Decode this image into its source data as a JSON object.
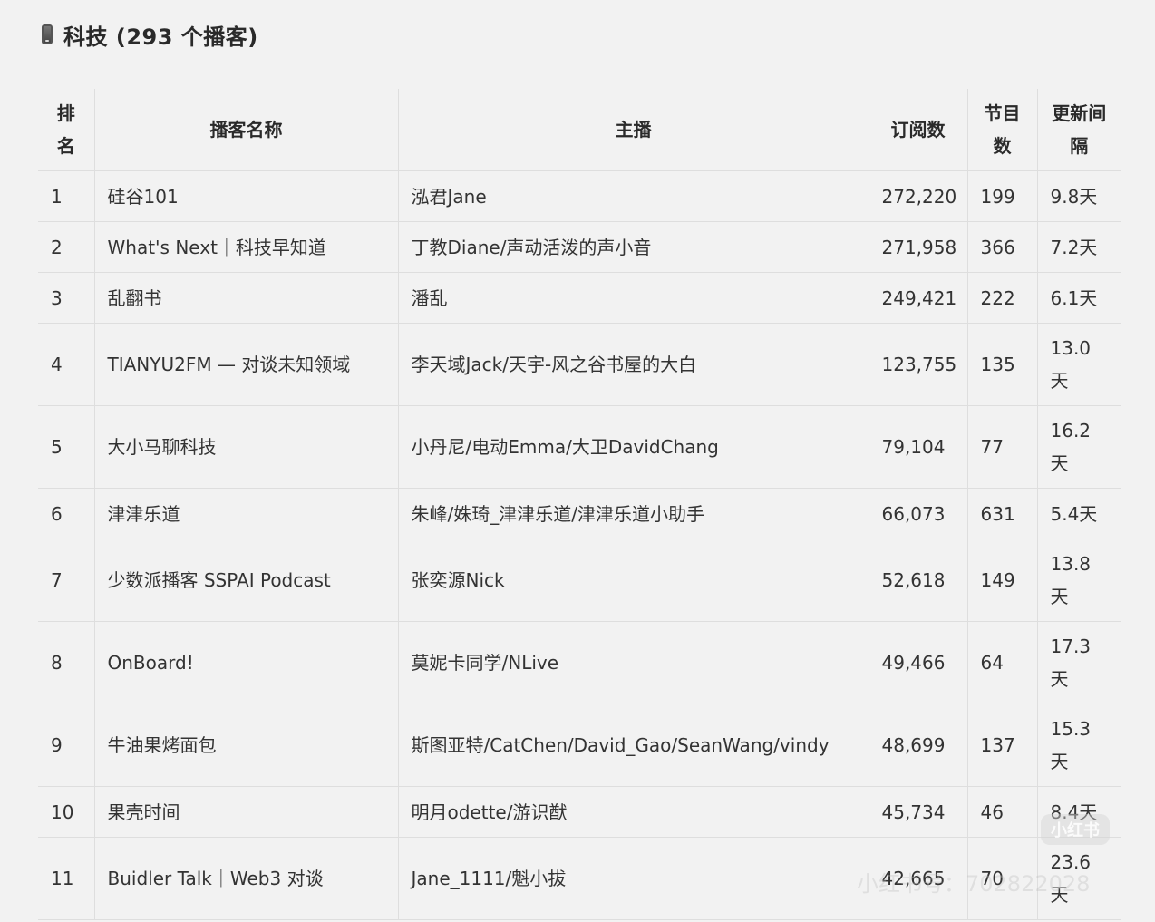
{
  "heading": {
    "icon": "mobile-phone-icon",
    "title": "科技 (293 个播客)"
  },
  "table": {
    "headers": {
      "rank": "排名",
      "name": "播客名称",
      "host": "主播",
      "subscribers": "订阅数",
      "episodes": "节目数",
      "interval": "更新间隔"
    },
    "rows": [
      {
        "rank": "1",
        "name": "硅谷101",
        "host": "泓君Jane",
        "subscribers": "272,220",
        "episodes": "199",
        "interval": "9.8天"
      },
      {
        "rank": "2",
        "name": "What's Next｜科技早知道",
        "host": "丁教Diane/声动活泼的声小音",
        "subscribers": "271,958",
        "episodes": "366",
        "interval": "7.2天"
      },
      {
        "rank": "3",
        "name": "乱翻书",
        "host": "潘乱",
        "subscribers": "249,421",
        "episodes": "222",
        "interval": "6.1天"
      },
      {
        "rank": "4",
        "name": "TIANYU2FM — 对谈未知领域",
        "host": "李天域Jack/天宇-风之谷书屋的大白",
        "subscribers": "123,755",
        "episodes": "135",
        "interval": "13.0天"
      },
      {
        "rank": "5",
        "name": "大小马聊科技",
        "host": "小丹尼/电动Emma/大卫DavidChang",
        "subscribers": "79,104",
        "episodes": "77",
        "interval": "16.2天"
      },
      {
        "rank": "6",
        "name": "津津乐道",
        "host": "朱峰/姝琦_津津乐道/津津乐道小助手",
        "subscribers": "66,073",
        "episodes": "631",
        "interval": "5.4天"
      },
      {
        "rank": "7",
        "name": "少数派播客 SSPAI Podcast",
        "host": "张奕源Nick",
        "subscribers": "52,618",
        "episodes": "149",
        "interval": "13.8天"
      },
      {
        "rank": "8",
        "name": "OnBoard!",
        "host": "莫妮卡同学/NLive",
        "subscribers": "49,466",
        "episodes": "64",
        "interval": "17.3天"
      },
      {
        "rank": "9",
        "name": "牛油果烤面包",
        "host": "斯图亚特/CatChen/David_Gao/SeanWang/vindy",
        "subscribers": "48,699",
        "episodes": "137",
        "interval": "15.3天"
      },
      {
        "rank": "10",
        "name": "果壳时间",
        "host": "明月odette/游识猷",
        "subscribers": "45,734",
        "episodes": "46",
        "interval": "8.4天"
      },
      {
        "rank": "11",
        "name": "Buidler Talk｜Web3 对谈",
        "host": "Jane_1111/魁小拔",
        "subscribers": "42,665",
        "episodes": "70",
        "interval": "23.6天"
      }
    ]
  },
  "watermark": {
    "logo": "小红书",
    "text": "小红书号：702822028"
  }
}
